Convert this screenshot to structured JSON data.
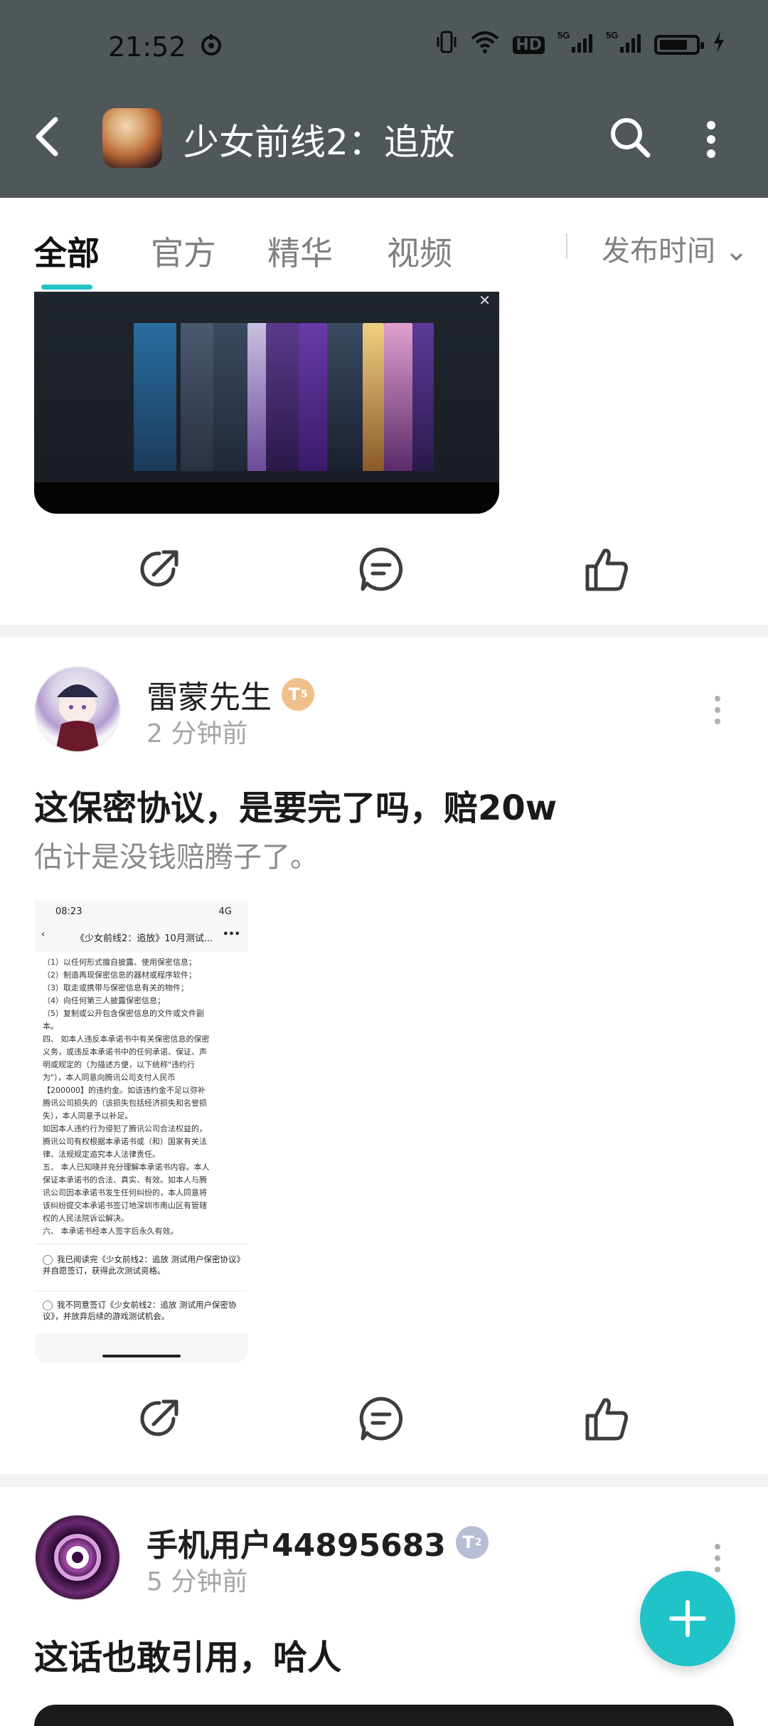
{
  "status_bar": {
    "time": "21:52",
    "network": "5G",
    "hd": "HD"
  },
  "header": {
    "title": "少女前线2：追放",
    "game_icon_tag": ""
  },
  "tabs": [
    {
      "label": "全部"
    },
    {
      "label": "官方"
    },
    {
      "label": "精华"
    },
    {
      "label": "视频"
    }
  ],
  "sort": {
    "label": "发布时间 ⌄"
  },
  "post1": {
    "image_caption": ""
  },
  "post2": {
    "username": "雷蒙先生",
    "level": "T",
    "level_sub": "5",
    "time": "2 分钟前",
    "title": "这保密协议，是要完了吗，赔20w",
    "body": "估计是没钱赔腾子了。",
    "screenshot": {
      "status_time": "08:23",
      "status_right": "4G",
      "nav_title": "《少女前线2：追放》10月测试...",
      "nav_more": "•••",
      "lines": [
        "（1）以任何形式擅自披露、使用保密信息；",
        "（2）制造再现保密信息的器材或程序软件；",
        "（3）取走或携带与保密信息有关的物件；",
        "（4）向任何第三人披露保密信息；",
        "（5）复制或公开包含保密信息的文件或文件副",
        "本。",
        "四、 如本人违反本承诺书中有关保密信息的保密",
        "义务，或违反本承诺书中的任何承诺、保证、声",
        "明或规定的（为描述方便，以下统称\"违约行",
        "为\"），本人同意向腾讯公司支付人民币",
        "【200000】的违约金。如该违约金不足以弥补",
        "腾讯公司损失的（该损失包括经济损失和名誉损",
        "失），本人同意予以补足。",
        "如因本人违约行为侵犯了腾讯公司合法权益的，",
        "腾讯公司有权根据本承诺书或（和）国家有关法",
        "律、法规规定追究本人法律责任。",
        "五、 本人已知晓并充分理解本承诺书内容。本人",
        "保证本承诺书的合法、真实、有效。如本人与腾",
        "讯公司因本承诺书发生任何纠纷的，本人同意将",
        "该纠纷提交本承诺书签订地深圳市南山区有管辖",
        "权的人民法院诉讼解决。",
        "六、 本承诺书经本人签字后永久有效。"
      ],
      "option1": "我已阅读完《少女前线2：追放 测试用户保密协议》并自愿签订，获得此次测试资格。",
      "option2": "我不同意签订《少女前线2：追放 测试用户保密协议》，并放弃后续的游戏测试机会。"
    }
  },
  "post3": {
    "username": "手机用户44895683",
    "level": "T",
    "level_sub": "2",
    "time": "5 分钟前",
    "title": "这话也敢引用，哈人"
  },
  "colors": {
    "accent": "#1fc3c8",
    "header_bg": "#50575a",
    "badge_gold": "#f0c08a",
    "badge_silver": "#b8bdd6"
  },
  "icons": [
    "back-arrow-icon",
    "search-icon",
    "more-vertical-icon",
    "share-icon",
    "comment-icon",
    "like-icon",
    "plus-icon"
  ]
}
